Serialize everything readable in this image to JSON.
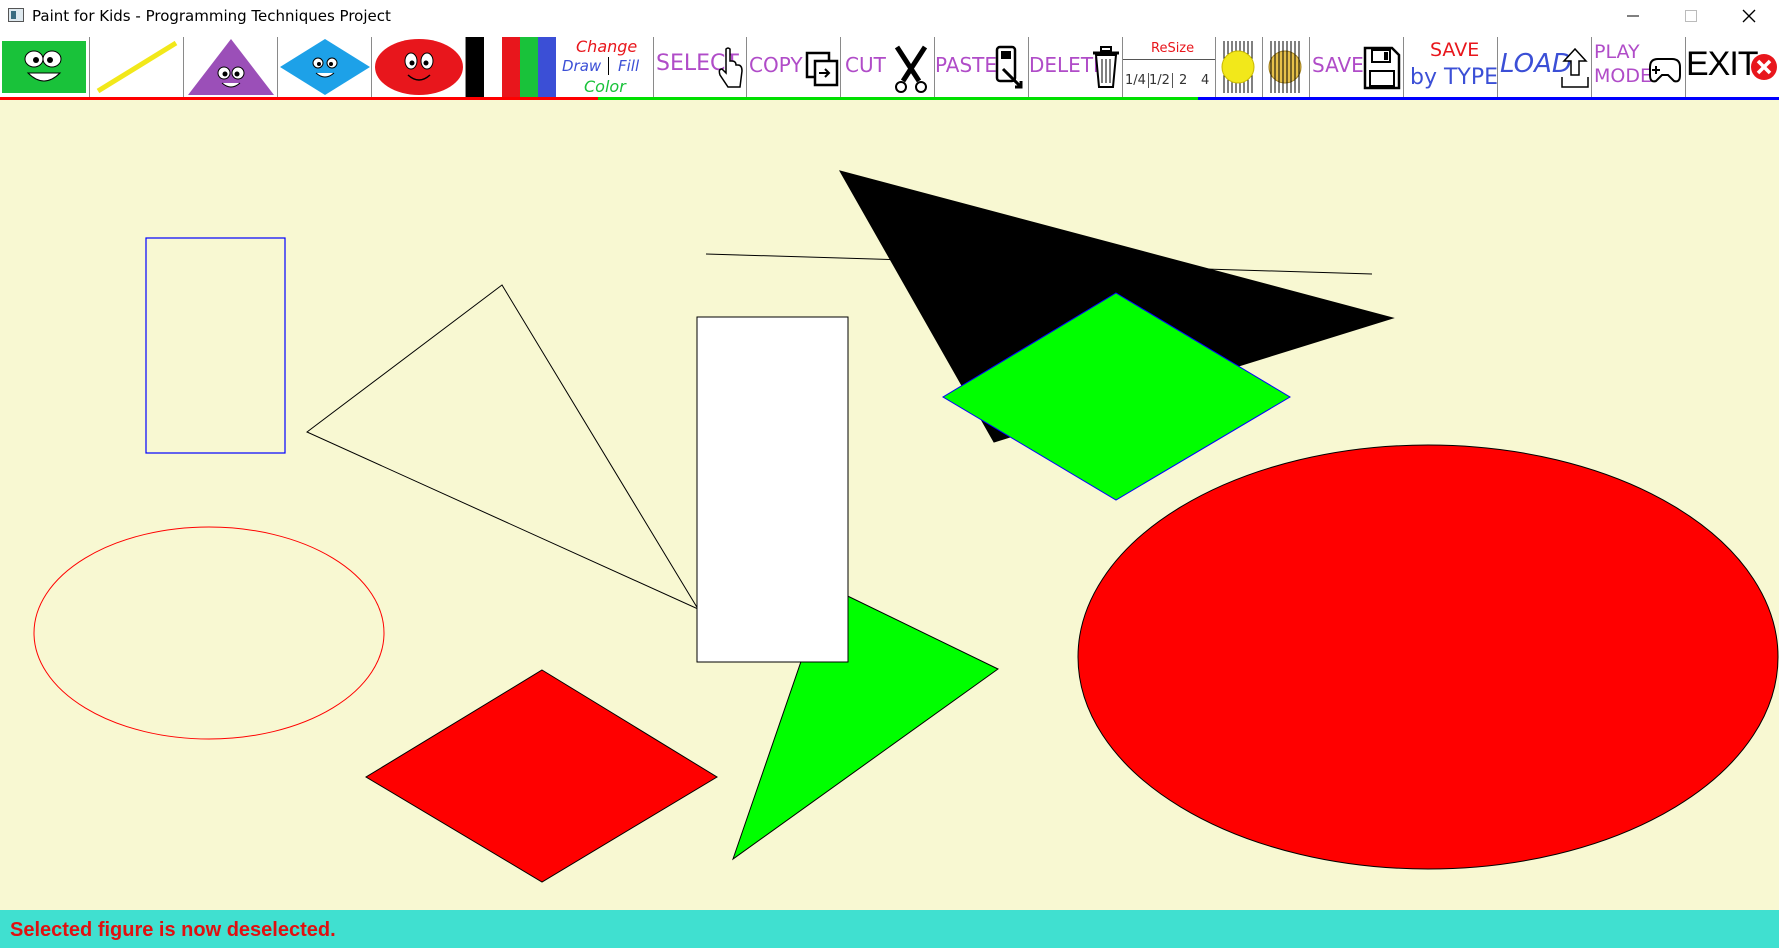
{
  "window": {
    "title": "Paint for Kids - Programming Techniques Project"
  },
  "toolbar": {
    "tools": [
      {
        "name": "rectangle",
        "icon": "green-rectangle-face-icon"
      },
      {
        "name": "line",
        "icon": "yellow-line-icon"
      },
      {
        "name": "triangle",
        "icon": "purple-triangle-face-icon"
      },
      {
        "name": "square",
        "icon": "blue-diamond-face-icon"
      },
      {
        "name": "ellipse",
        "icon": "red-ellipse-face-icon"
      },
      {
        "name": "colors",
        "icon": "color-swatch-icon"
      }
    ],
    "change_color": {
      "change": "Change",
      "draw": "Draw",
      "fill": "Fill",
      "color": "Color"
    },
    "select_label": "SELECT",
    "copy_label": "COPY",
    "cut_label": "CUT",
    "paste_label": "PASTE",
    "delete_label": "DELETE",
    "resize": {
      "label": "ReSize",
      "options": [
        "1/4",
        "1/2",
        "2",
        "4"
      ]
    },
    "save_label": "SAVE",
    "save_by_type": {
      "line1": "SAVE",
      "line2": "by TYPE"
    },
    "load_label": "LOAD",
    "play_mode": {
      "line1": "PLAY",
      "line2": "MODE"
    },
    "exit_label": "EXIT",
    "swatches": [
      "#000000",
      "#ffffff",
      "#e8161c",
      "#19c23a",
      "#3b4fd6"
    ]
  },
  "colors": {
    "canvas_bg": "#f8f8d2",
    "status_bg": "#40e0d0",
    "status_text": "#e01010",
    "red": "#ff0000",
    "green": "#00ff00",
    "black": "#000000",
    "blue": "#0000ff"
  },
  "status": {
    "message": "Selected figure is now deselected."
  }
}
